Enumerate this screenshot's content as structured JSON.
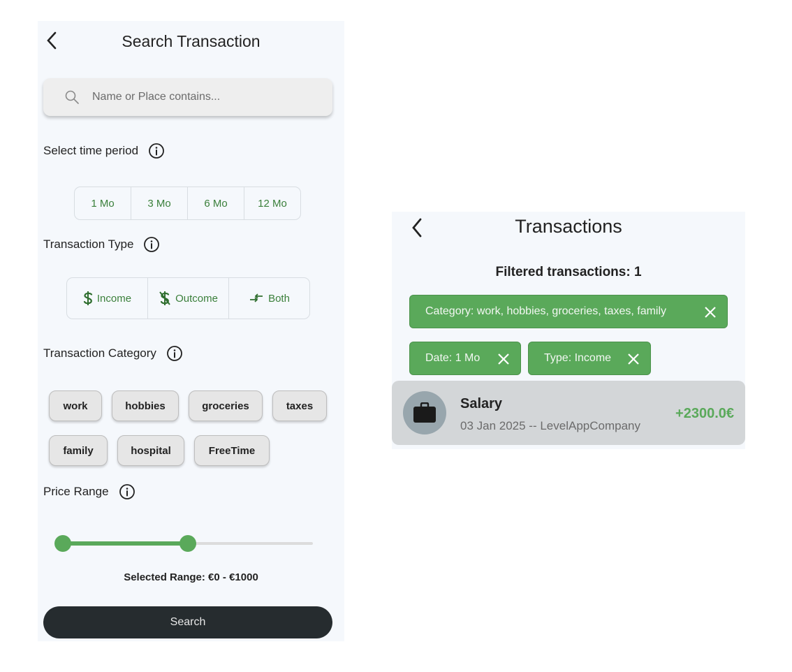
{
  "search_screen": {
    "title": "Search Transaction",
    "search": {
      "placeholder": "Name or Place contains..."
    },
    "time_period": {
      "label": "Select time period",
      "options": [
        "1 Mo",
        "3 Mo",
        "6 Mo",
        "12 Mo"
      ]
    },
    "transaction_type": {
      "label": "Transaction Type",
      "options": [
        {
          "label": "Income",
          "icon": "dollar-icon"
        },
        {
          "label": "Outcome",
          "icon": "dollar-crossed-icon"
        },
        {
          "label": "Both",
          "icon": "swap-arrows-icon"
        }
      ]
    },
    "transaction_category": {
      "label": "Transaction Category",
      "chips": [
        "work",
        "hobbies",
        "groceries",
        "taxes",
        "family",
        "hospital",
        "FreeTime"
      ]
    },
    "price_range": {
      "label": "Price Range",
      "selected_text": "Selected Range: €0 - €1000"
    },
    "search_button": "Search",
    "accent_color": "#5aa95a",
    "button_color": "#262c2f"
  },
  "results_screen": {
    "title": "Transactions",
    "filtered_count": "Filtered transactions: 1",
    "filters": [
      "Category: work, hobbies, groceries, taxes, family",
      "Date: 1 Mo",
      "Type: Income"
    ],
    "transaction": {
      "name": "Salary",
      "meta": "03 Jan 2025 -- LevelAppCompany",
      "amount": "+2300.0€",
      "icon": "briefcase-icon"
    }
  }
}
